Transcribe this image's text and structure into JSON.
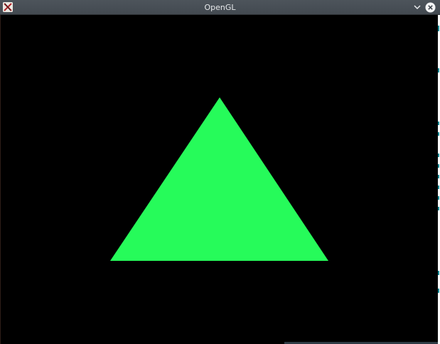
{
  "window": {
    "title": "OpenGL",
    "app_icon": "x11-icon",
    "buttons": {
      "minimize": "chevron-down-icon",
      "close": "close-icon"
    }
  },
  "scene": {
    "background_color": "#000000",
    "shape": "triangle",
    "fill_color": "#26fb5a"
  }
}
